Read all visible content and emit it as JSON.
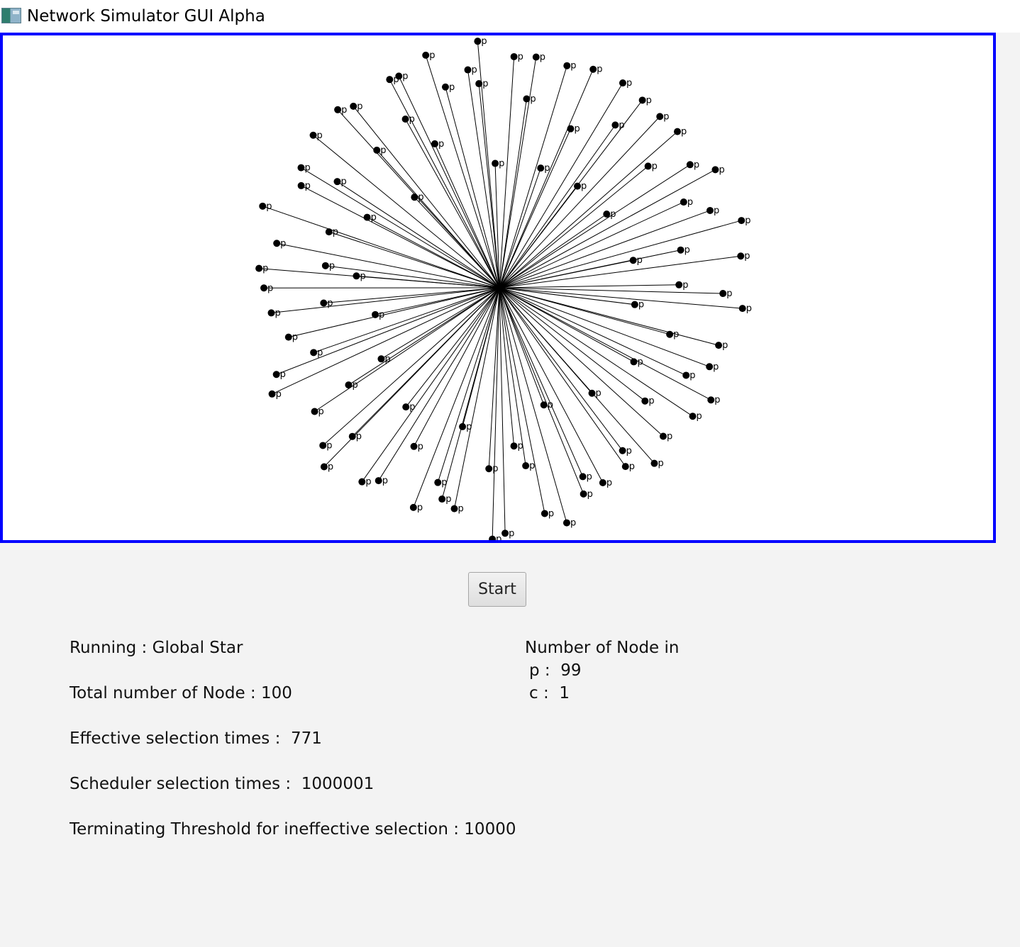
{
  "window": {
    "title": "Network Simulator GUI Alpha"
  },
  "controls": {
    "start_label": "Start"
  },
  "stats": {
    "running_label": "Running : ",
    "running_value": "Global Star",
    "total_label": "Total number of Node : ",
    "total_value": "100",
    "effective_label": "Effective selection times :  ",
    "effective_value": "771",
    "scheduler_label": "Scheduler selection times :  ",
    "scheduler_value": "1000001",
    "threshold_label": "Terminating Threshold for ineffective selection : ",
    "threshold_value": "10000"
  },
  "node_counts": {
    "heading": "Number of Node in",
    "rows": [
      {
        "state": "p",
        "count": "99"
      },
      {
        "state": "c",
        "count": "1"
      }
    ]
  },
  "network": {
    "topology": "star",
    "center_state": "c",
    "leaf_state": "p",
    "leaf_label": "p",
    "colors": {
      "edge": "#000000",
      "node": "#000000",
      "border": "#0000ff"
    }
  }
}
